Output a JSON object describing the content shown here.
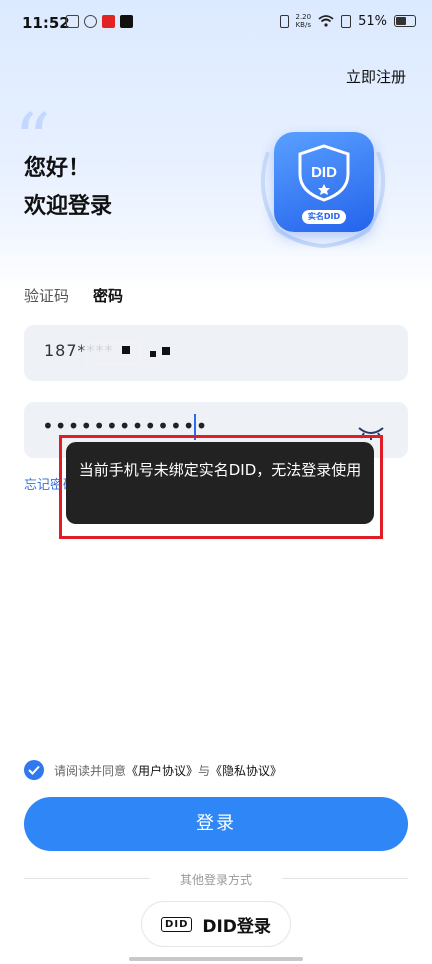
{
  "status_bar": {
    "time": "11:52",
    "net_speed_value": "2.20",
    "net_speed_unit": "KB/s",
    "battery": "51%"
  },
  "header": {
    "register_link": "立即注册",
    "greeting_line1": "您好！",
    "greeting_line2": "欢迎登录",
    "badge_text": "DID",
    "badge_caption": "实名DID"
  },
  "tabs": {
    "code": "验证码",
    "password": "密码",
    "active": "password"
  },
  "form": {
    "phone_value": "187****",
    "password_dots": "•••••••••••••",
    "forgot_label": "忘记密码?"
  },
  "toast": {
    "message": "当前手机号未绑定实名DID，无法登录使用"
  },
  "agreement": {
    "checked": true,
    "prefix": "请阅读并同意",
    "user_agreement": "《用户协议》",
    "and": "与",
    "privacy_agreement": "《隐私协议》"
  },
  "login_button": "登录",
  "other_login": {
    "title": "其他登录方式",
    "did_logo": "DID",
    "did_label": "DID登录"
  },
  "colors": {
    "primary": "#2f86f6",
    "toast_bg": "#222222",
    "highlight_border": "#e01d25"
  }
}
